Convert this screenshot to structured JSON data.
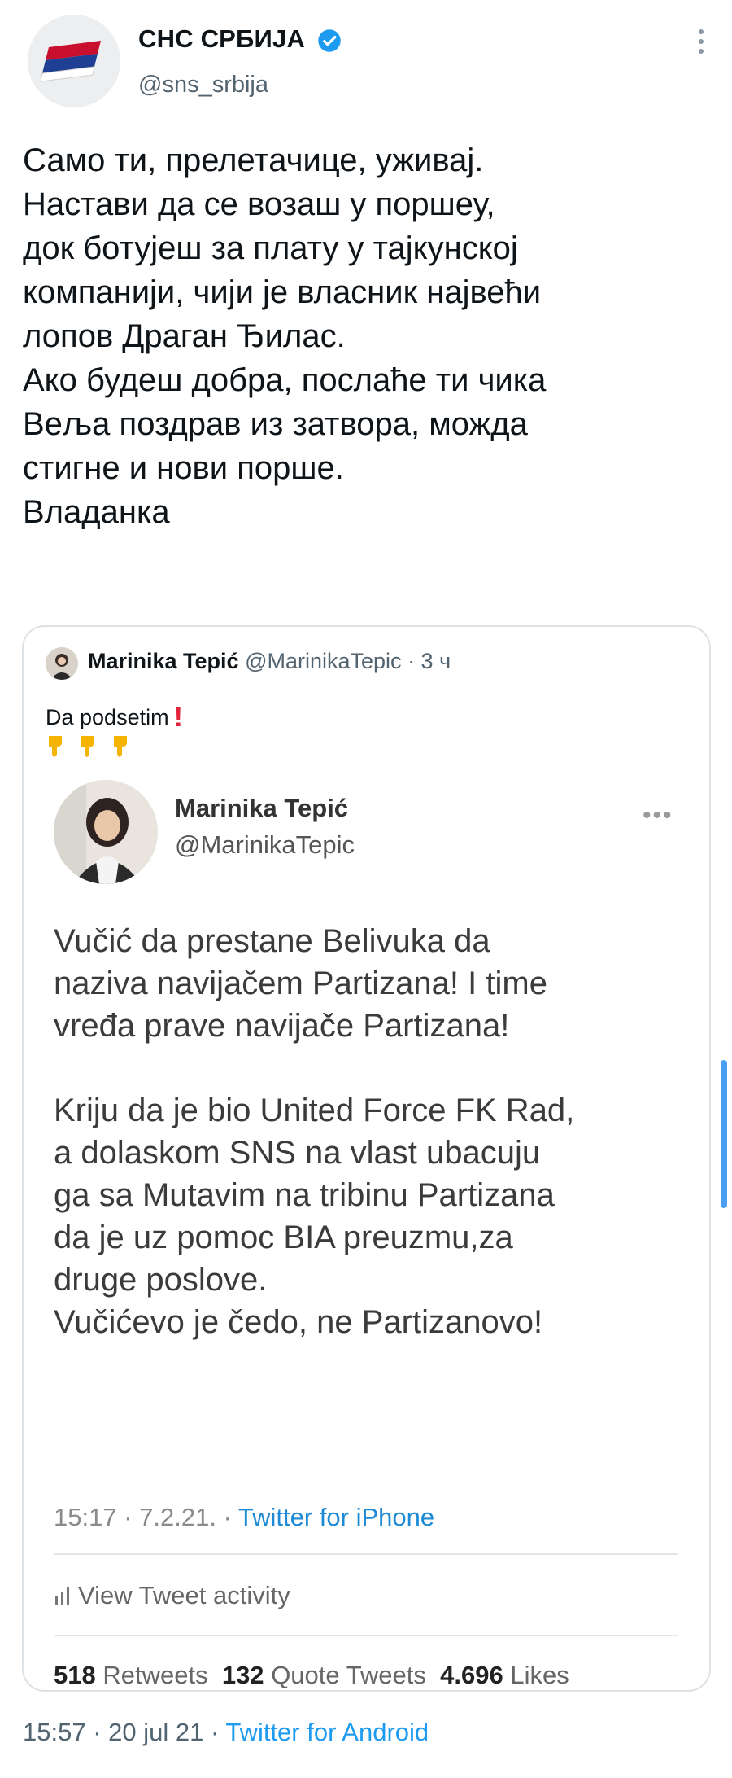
{
  "header": {
    "display_name": "СНС СРБИЈА",
    "handle": "@sns_srbija",
    "verified": true,
    "accent": "#1d9bf0"
  },
  "tweet": {
    "text": "Само ти, прелетачице, уживај.\nНастави да се возаш у поршеу,\nдок ботујеш за плату у тајкунској\nкомпанији, чији је власник највећи\nлопов Драган Ђилас.\nАко будеш добра, послаће ти чика\nВеља поздрав из затвора, можда\nстигне и нови порше.\nВладанка"
  },
  "quote": {
    "name": "Marinika Tepić",
    "handle": "@MarinikaTepic",
    "time": "· 3 ч",
    "text": "Da podsetim",
    "icons": [
      "exclamation-icon",
      "pointing-down-icon"
    ]
  },
  "embedded": {
    "name": "Marinika Tepić",
    "handle": "@MarinikaTepic",
    "text": "Vučić da prestane Belivuka da\nnaziva navijačem Partizana! I time\nvređa prave navijače Partizana!\n\nKriju da je bio United Force FK Rad,\na dolaskom SNS na vlast ubacuju\nga sa Mutavim na tribinu Partizana\nda je uz pomoc BIA preuzmu,za\ndruge poslove.\nVučićevo je čedo, ne Partizanovo!",
    "meta_time": "15:17 · 7.2.21. · ",
    "meta_source": "Twitter for iPhone",
    "activity_label": "View Tweet activity",
    "retweets_count": "518",
    "retweets_label": "Retweets",
    "quotes_count": "132",
    "quotes_label": "Quote Tweets",
    "likes_count": "4.696",
    "likes_label": "Likes"
  },
  "footer": {
    "time": "15:57 · 20 jul 21 · ",
    "source": "Twitter for Android"
  }
}
